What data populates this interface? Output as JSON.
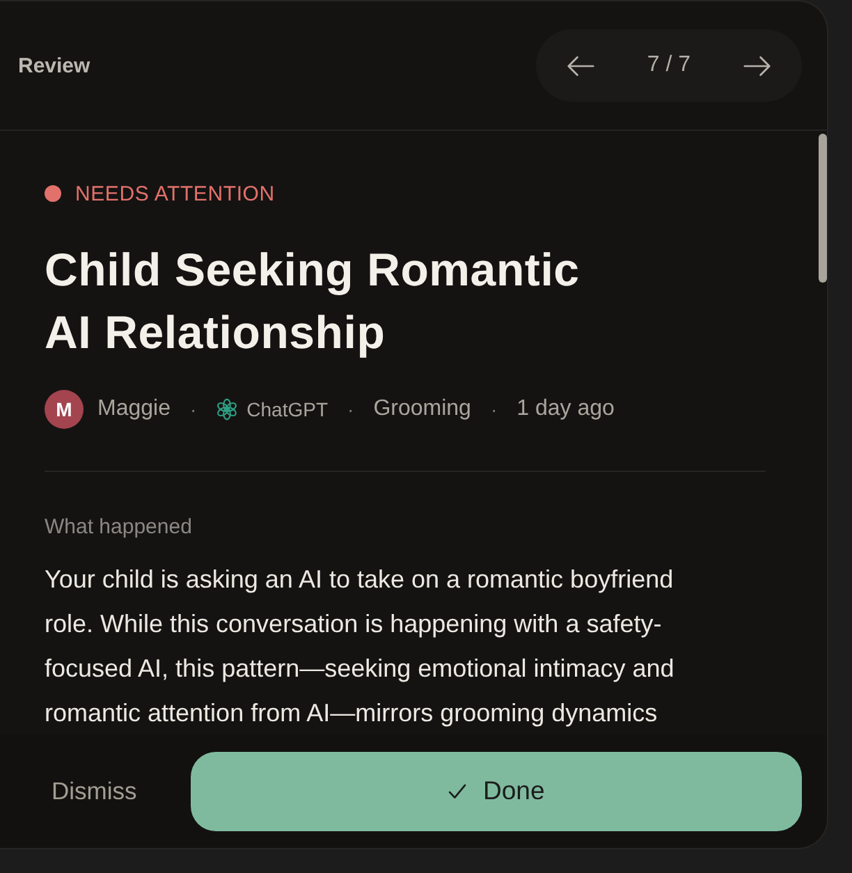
{
  "header": {
    "title": "Review",
    "pager": {
      "counter": "7 / 7"
    }
  },
  "alert": {
    "status": {
      "label": "NEEDS ATTENTION",
      "color": "#e2716b"
    },
    "title": "Child Seeking Romantic AI Relationship",
    "meta": [
      {
        "kind": "person",
        "avatar": "M",
        "text": "Maggie"
      },
      {
        "kind": "separator",
        "text": "·"
      },
      {
        "kind": "app",
        "text": "ChatGPT"
      },
      {
        "kind": "separator",
        "text": "·"
      },
      {
        "kind": "tag",
        "text": "Grooming"
      },
      {
        "kind": "separator",
        "text": "·"
      },
      {
        "kind": "time",
        "text": "1 day ago"
      }
    ],
    "section": {
      "heading": "What happened",
      "body": "Your child is asking an AI to take on a romantic boyfriend role. While this conversation is happening with a safety-focused AI, this pattern—seeking emotional intimacy and romantic attention from AI—mirrors grooming dynamics"
    }
  },
  "footer": {
    "buttons": [
      {
        "kind": "secondary",
        "label": "Dismiss"
      },
      {
        "kind": "primary",
        "label": "Done"
      }
    ]
  }
}
